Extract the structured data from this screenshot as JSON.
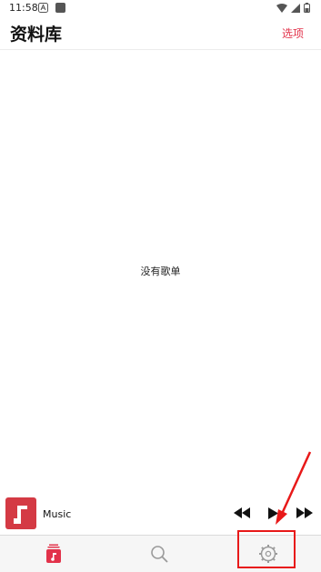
{
  "status_bar": {
    "time": "11:58"
  },
  "header": {
    "title": "资料库",
    "options_label": "选项"
  },
  "main": {
    "empty_text": "没有歌单"
  },
  "mini_player": {
    "track": "Music"
  },
  "tabs": [
    {
      "icon": "library-icon",
      "active": true
    },
    {
      "icon": "search-icon",
      "active": false
    },
    {
      "icon": "settings-icon",
      "active": false
    }
  ],
  "colors": {
    "accent": "#e2324a",
    "album_art": "#d43a44",
    "annotation": "#e81919"
  }
}
